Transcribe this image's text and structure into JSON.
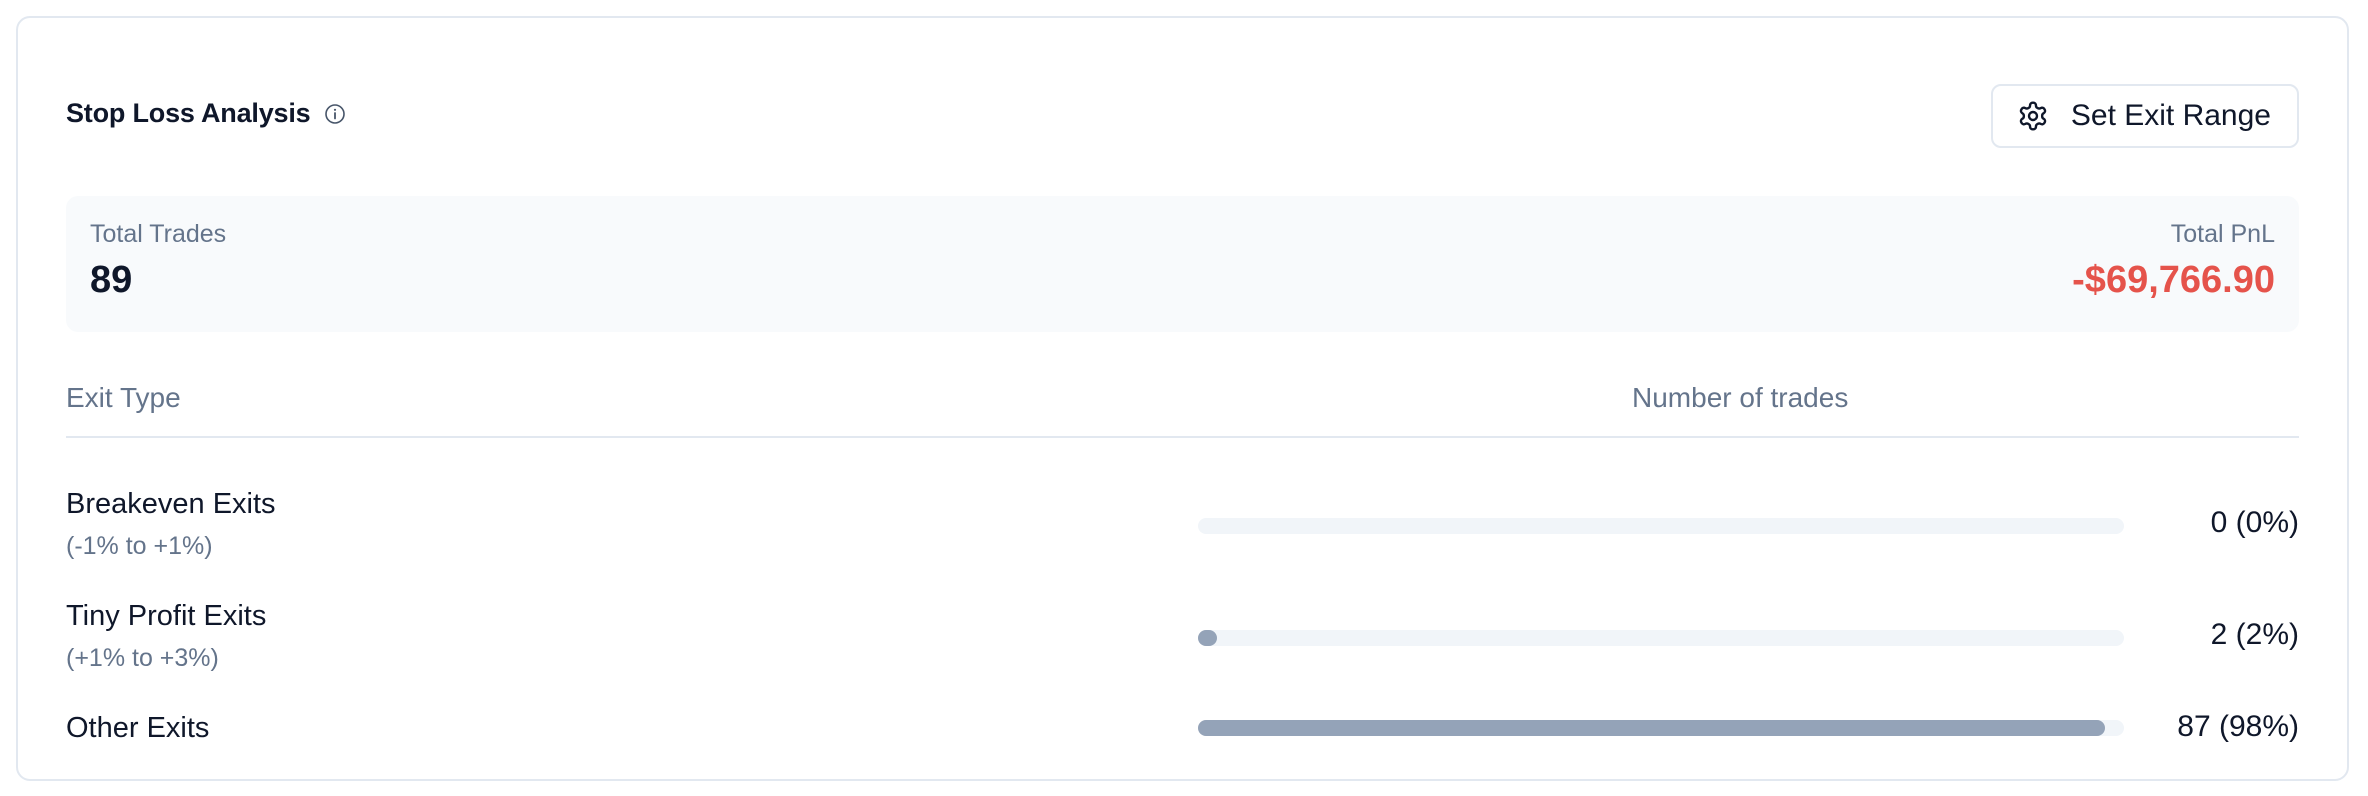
{
  "header": {
    "title": "Stop Loss Analysis",
    "info_icon": "info-circle-icon",
    "exit_button": {
      "label": "Set Exit Range",
      "icon": "gear-icon"
    }
  },
  "summary": {
    "total_trades_label": "Total Trades",
    "total_trades_value": "89",
    "total_pnl_label": "Total PnL",
    "total_pnl_value": "-$69,766.90"
  },
  "table": {
    "columns": [
      "Exit Type",
      "Number of trades"
    ],
    "rows": [
      {
        "name": "Breakeven Exits",
        "range": "(-1% to +1%)",
        "value": "0 (0%)",
        "fraction": 0
      },
      {
        "name": "Tiny Profit Exits",
        "range": "(+1% to +3%)",
        "value": "2 (2%)",
        "fraction": 0.02
      },
      {
        "name": "Other Exits",
        "range": "",
        "value": "87 (98%)",
        "fraction": 0.98
      }
    ]
  },
  "colors": {
    "negative": "#e5534b",
    "bar_fill": "#94a3b8",
    "bar_track": "#f1f5f9"
  }
}
